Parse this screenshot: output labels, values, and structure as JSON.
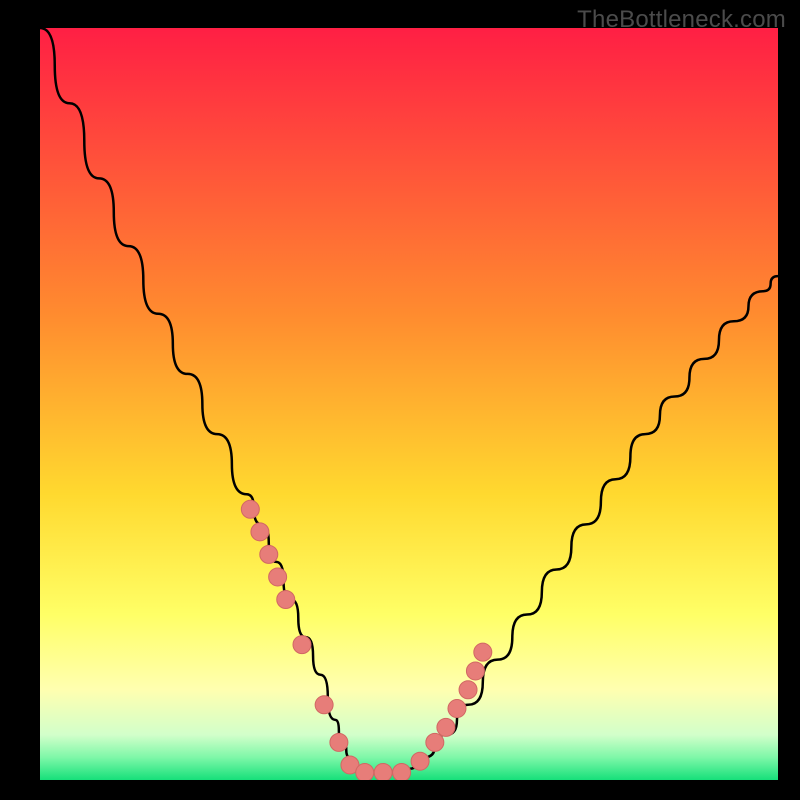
{
  "watermark": "TheBottleneck.com",
  "colors": {
    "frame_bg": "#000000",
    "gradient_top": "#ff1f44",
    "gradient_mid_upper": "#ffb52f",
    "gradient_mid_lower": "#ffff66",
    "gradient_pale_yellow": "#ffffc2",
    "gradient_green": "#16e07a",
    "curve_stroke": "#000000",
    "marker_fill": "#e77d79",
    "marker_stroke": "#d16763"
  },
  "chart_data": {
    "type": "line",
    "title": "",
    "xlabel": "",
    "ylabel": "",
    "xlim": [
      0,
      100
    ],
    "ylim": [
      0,
      100
    ],
    "grid": false,
    "legend": false,
    "series": [
      {
        "name": "bottleneck-curve",
        "x": [
          0,
          4,
          8,
          12,
          16,
          20,
          24,
          28,
          30,
          32,
          34,
          36,
          38,
          40,
          41,
          42,
          43,
          44,
          46,
          48,
          50,
          52,
          55,
          58,
          62,
          66,
          70,
          74,
          78,
          82,
          86,
          90,
          94,
          98,
          100
        ],
        "y": [
          100,
          90,
          80,
          71,
          62,
          54,
          46,
          38,
          34,
          29,
          24,
          19,
          14,
          8,
          5,
          3,
          1.5,
          1,
          1,
          1,
          1.5,
          3,
          6,
          10,
          16,
          22,
          28,
          34,
          40,
          46,
          51,
          56,
          61,
          65,
          67
        ]
      }
    ],
    "markers": {
      "name": "highlight-dots",
      "x": [
        28.5,
        29.8,
        31,
        32.2,
        33.3,
        35.5,
        38.5,
        40.5,
        42,
        44,
        46.5,
        49,
        51.5,
        53.5,
        55,
        56.5,
        58,
        59,
        60
      ],
      "y": [
        36,
        33,
        30,
        27,
        24,
        18,
        10,
        5,
        2,
        1,
        1,
        1,
        2.5,
        5,
        7,
        9.5,
        12,
        14.5,
        17
      ]
    }
  }
}
